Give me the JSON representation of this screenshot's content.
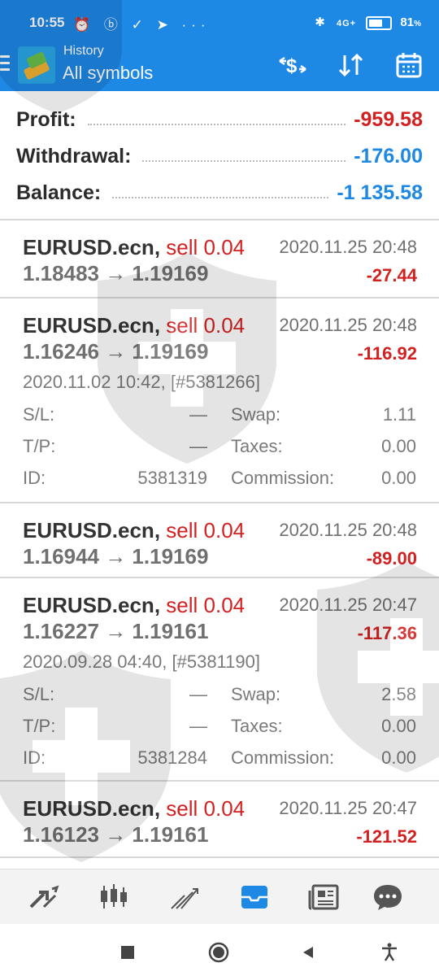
{
  "status_bar": {
    "time": "10:55",
    "left_icons": "⏰ ⓑ ✓ ➤ ···",
    "bluetooth": "✱",
    "signal": "4G+",
    "battery_percent": 81,
    "battery_label": "81"
  },
  "app_bar": {
    "title": "History",
    "subtitle": "All symbols",
    "icons": [
      "currency-exchange-icon",
      "sort-icon",
      "calendar-icon"
    ]
  },
  "summary": {
    "profit_label": "Profit:",
    "profit_value": "-959.58",
    "withdrawal_label": "Withdrawal:",
    "withdrawal_value": "-176.00",
    "balance_label": "Balance:",
    "balance_value": "-1 135.58"
  },
  "trades": [
    {
      "symbol": "EURUSD.ecn,",
      "side": "sell 0.04",
      "prices": "1.18483 → 1.19169",
      "date": "2020.11.25 20:48",
      "profit": "-27.44"
    },
    {
      "symbol": "EURUSD.ecn,",
      "side": "sell 0.04",
      "prices": "1.16246 → 1.19169",
      "date": "2020.11.25 20:48",
      "profit": "-116.92",
      "open_info": "2020.11.02 10:42, [#5381266]",
      "sl_label": "S/L:",
      "sl_value": "—",
      "swap_label": "Swap:",
      "swap_value": "1.11",
      "tp_label": "T/P:",
      "tp_value": "—",
      "taxes_label": "Taxes:",
      "taxes_value": "0.00",
      "id_label": "ID:",
      "id_value": "5381319",
      "commission_label": "Commission:",
      "commission_value": "0.00"
    },
    {
      "symbol": "EURUSD.ecn,",
      "side": "sell 0.04",
      "prices": "1.16944 → 1.19169",
      "date": "2020.11.25 20:48",
      "profit": "-89.00"
    },
    {
      "symbol": "EURUSD.ecn,",
      "side": "sell 0.04",
      "prices": "1.16227 → 1.19161",
      "date": "2020.11.25 20:47",
      "profit": "-117.36",
      "open_info": "2020.09.28 04:40, [#5381190]",
      "sl_label": "S/L:",
      "sl_value": "—",
      "swap_label": "Swap:",
      "swap_value": "2.58",
      "tp_label": "T/P:",
      "tp_value": "—",
      "taxes_label": "Taxes:",
      "taxes_value": "0.00",
      "id_label": "ID:",
      "id_value": "5381284",
      "commission_label": "Commission:",
      "commission_value": "0.00"
    },
    {
      "symbol": "EURUSD.ecn,",
      "side": "sell 0.04",
      "prices": "1.16123 → 1.19161",
      "date": "2020.11.25 20:47",
      "profit": "-121.52"
    }
  ],
  "bottom_tabs": [
    "quotes-icon",
    "chart-icon",
    "trade-icon",
    "history-icon",
    "news-icon",
    "chat-icon"
  ],
  "active_tab": "history-icon",
  "colors": {
    "accent": "#1e88e5",
    "negative": "#d32121",
    "text": "#333333",
    "muted": "#707070"
  }
}
